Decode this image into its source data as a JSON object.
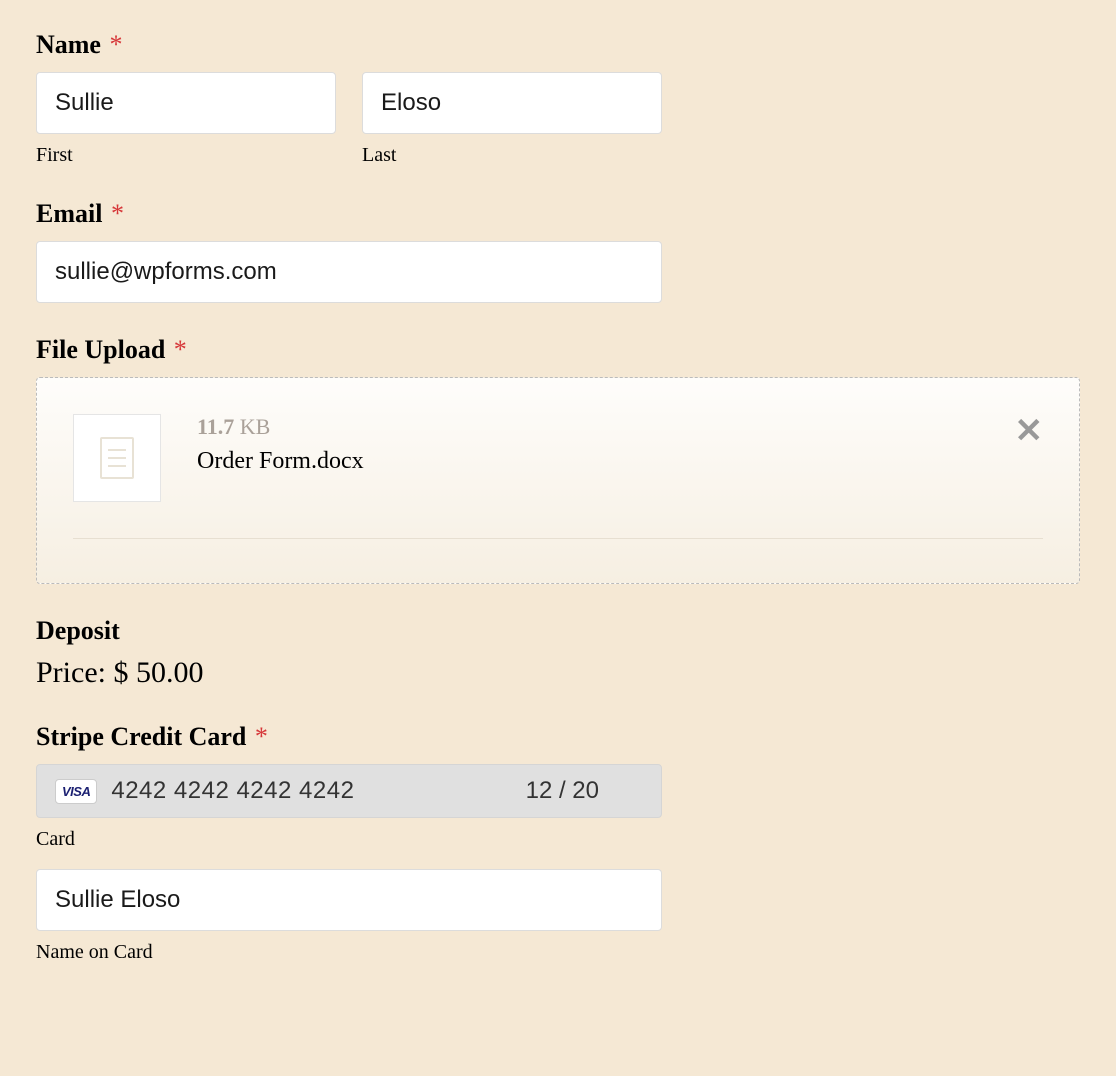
{
  "name": {
    "label": "Name",
    "required": "*",
    "first_value": "Sullie",
    "first_sub": "First",
    "last_value": "Eloso",
    "last_sub": "Last"
  },
  "email": {
    "label": "Email",
    "required": "*",
    "value": "sullie@wpforms.com"
  },
  "upload": {
    "label": "File Upload",
    "required": "*",
    "file_size": "11.7",
    "file_size_unit": " KB",
    "file_name": "Order Form.docx"
  },
  "deposit": {
    "label": "Deposit",
    "price_prefix": "Price: ",
    "price_value": "$ 50.00"
  },
  "stripe": {
    "label": "Stripe Credit Card",
    "required": "*",
    "brand": "VISA",
    "card_number": "4242 4242 4242 4242",
    "expiry": "12 / 20",
    "card_sub": "Card",
    "name_on_card": "Sullie Eloso",
    "name_sub": "Name on Card"
  }
}
